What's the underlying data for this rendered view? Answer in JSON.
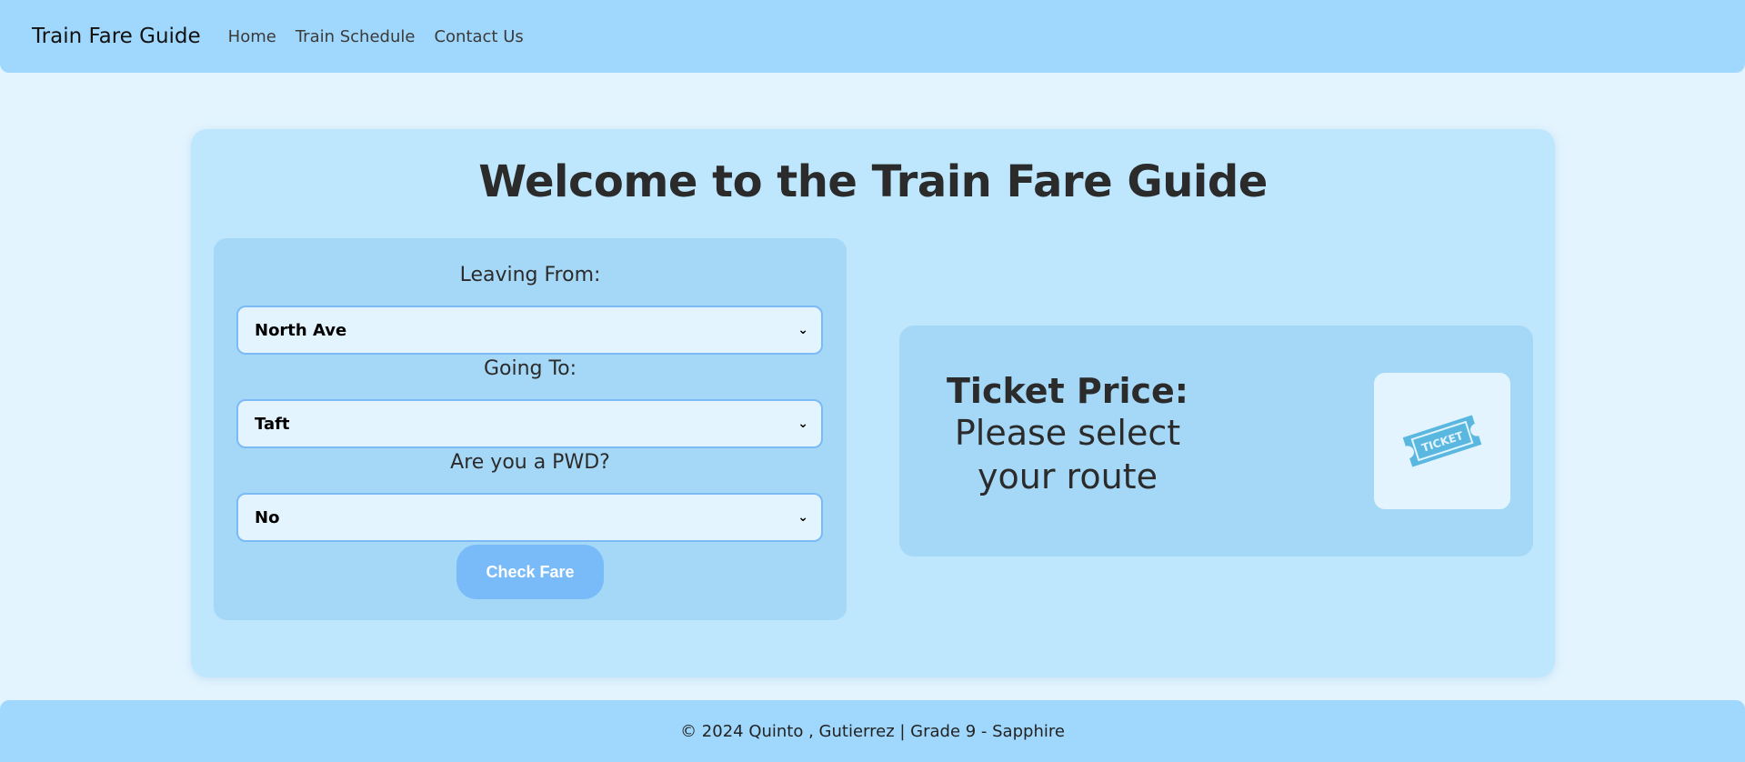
{
  "navbar": {
    "brand": "Train Fare Guide",
    "links": [
      "Home",
      "Train Schedule",
      "Contact Us"
    ]
  },
  "main": {
    "title": "Welcome to the Train Fare Guide",
    "form": {
      "leaving_label": "Leaving From:",
      "leaving_value": "North Ave",
      "going_label": "Going To:",
      "going_value": "Taft",
      "pwd_label": "Are you a PWD?",
      "pwd_value": "No",
      "check_button": "Check Fare"
    },
    "price": {
      "title": "Ticket Price:",
      "message": "Please select your route",
      "ticket_icon_text": "TICKET"
    }
  },
  "footer": {
    "text": "© 2024 Quinto , Gutierrez | Grade 9 - Sapphire"
  },
  "colors": {
    "nav_bg": "#a0d8fd",
    "page_bg": "#e3f4fe",
    "card_bg": "#bee6fd",
    "panel_bg": "#a5d8f7",
    "button_bg": "#78bbf8",
    "ticket_icon": "#5ab8e0"
  }
}
